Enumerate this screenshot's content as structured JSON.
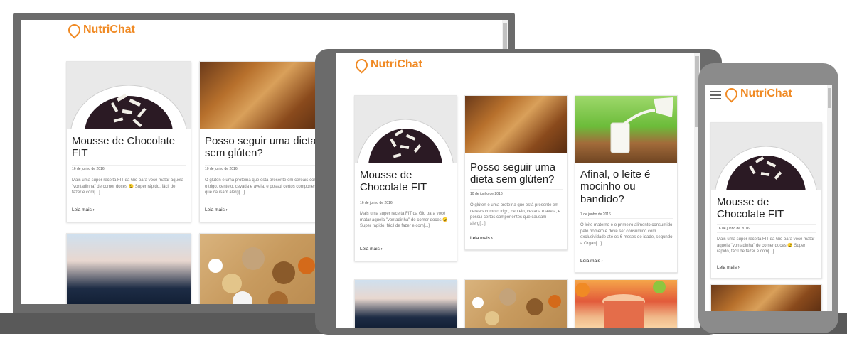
{
  "brand": {
    "name": "NutriChat",
    "color": "#f08a24"
  },
  "posts": [
    {
      "title": "Mousse de Chocolate FIT",
      "date": "16 de junho de 2016",
      "excerpt": "Mais uma super receita FIT da Gio para você matar aquela \"vontadinha\" de comer doces 😉 Super rápido, fácil de fazer e com[...]",
      "more": "Leia mais ›"
    },
    {
      "title": "Posso seguir uma dieta sem glúten?",
      "date": "10 de junho de 2016",
      "excerpt": "O glúten é uma proteína que está presente em cereais como o trigo, centeio, cevada e aveia, e possui certos componentes que causam alerg[...]",
      "more": "Leia mais ›"
    },
    {
      "title": "Afinal, o leite é mocinho ou bandido?",
      "date": "7 de junho de 2016",
      "excerpt": "O leite materno é o primeiro alimento consumido pelo homem e deve ser consumido com exclusividade até os 6 meses de idade, segundo a Organ[...]",
      "more": "Leia mais ›"
    }
  ],
  "desktop_excerpts": {
    "p0": "Mais uma super receita FIT da Gio para você matar aquela \"vontadinha\" de comer doces 😉 Super rápido, fácil de fazer e com[...]",
    "p1": "O glúten é uma proteína que está presente em cereais como o trigo, centeio, cevada e aveia, e possui certos componentes que causam alerg[...]"
  }
}
